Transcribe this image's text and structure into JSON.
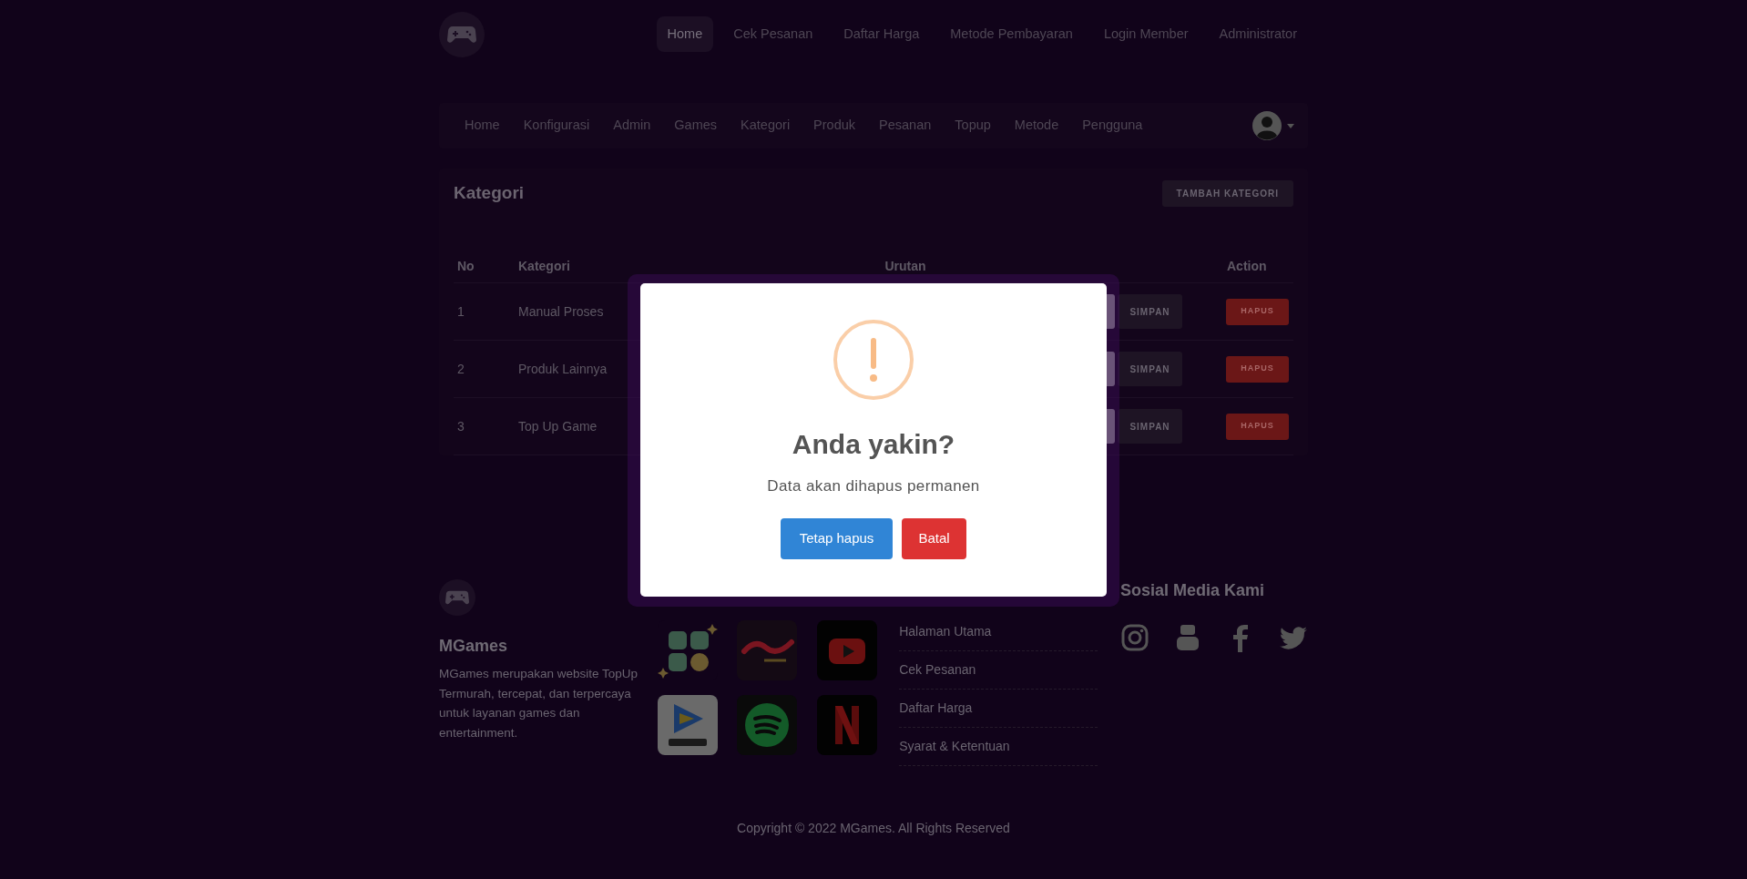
{
  "top_nav": {
    "items": [
      {
        "label": "Home",
        "selected": true
      },
      {
        "label": "Cek Pesanan",
        "selected": false
      },
      {
        "label": "Daftar Harga",
        "selected": false
      },
      {
        "label": "Metode Pembayaran",
        "selected": false
      },
      {
        "label": "Login Member",
        "selected": false
      },
      {
        "label": "Administrator",
        "selected": false
      }
    ]
  },
  "admin_nav": {
    "items": [
      "Home",
      "Konfigurasi",
      "Admin",
      "Games",
      "Kategori",
      "Produk",
      "Pesanan",
      "Topup",
      "Metode",
      "Pengguna"
    ]
  },
  "card": {
    "title": "Kategori",
    "add_button": "TAMBAH KATEGORI"
  },
  "table": {
    "columns": [
      "No",
      "Kategori",
      "Urutan",
      "Action"
    ],
    "rows": [
      {
        "no": "1",
        "kategori": "Manual Proses",
        "save_button": "SIMPAN",
        "delete_button": "HAPUS"
      },
      {
        "no": "2",
        "kategori": "Produk Lainnya",
        "save_button": "SIMPAN",
        "delete_button": "HAPUS"
      },
      {
        "no": "3",
        "kategori": "Top Up Game",
        "save_button": "SIMPAN",
        "delete_button": "HAPUS"
      }
    ]
  },
  "dialog": {
    "title": "Anda yakin?",
    "message": "Data akan dihapus permanen",
    "buttons": [
      {
        "label": "Tetap hapus",
        "kind": "confirm"
      },
      {
        "label": "Batal",
        "kind": "cancel"
      }
    ]
  },
  "footer": {
    "brand": "MGames",
    "description": "MGames merupakan website TopUp Termurah, tercepat, dan terpercaya untuk layanan games dan entertainment.",
    "app_tiles": [
      {
        "kind": "wallet"
      },
      {
        "kind": "video"
      },
      {
        "kind": "play"
      },
      {
        "kind": "stream"
      },
      {
        "kind": "music"
      },
      {
        "kind": "ribbon"
      }
    ],
    "links": [
      "Halaman Utama",
      "Cek Pesanan",
      "Daftar Harga",
      "Syarat & Ketentuan"
    ],
    "social_title": "Sosial Media Kami",
    "social": [
      {
        "kind": "camera"
      },
      {
        "kind": "tube"
      },
      {
        "kind": "f"
      },
      {
        "kind": "bird"
      }
    ]
  },
  "copyright": "Copyright © 2022 MGames. All Rights Reserved"
}
